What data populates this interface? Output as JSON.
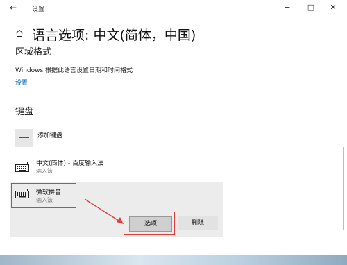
{
  "window": {
    "title": "设置",
    "back_glyph": "←",
    "minimize_glyph": "−",
    "maximize_glyph": "□",
    "close_glyph": "✕"
  },
  "header": {
    "icon": "home-icon",
    "title": "语言选项: 中文(简体，中国)"
  },
  "region": {
    "heading": "区域格式",
    "description": "Windows 根据此语言设置日期和时间格式",
    "link": "设置"
  },
  "keyboard": {
    "heading": "键盘",
    "add_label": "添加键盘",
    "items": [
      {
        "name": "中文(简体) - 百度输入法",
        "sub": "输入法",
        "icon": "keyboard-icon"
      },
      {
        "name": "微软拼音",
        "sub": "输入法",
        "icon": "keyboard-icon"
      }
    ],
    "options_button": "选项",
    "remove_button": "删除"
  },
  "colors": {
    "accent_link": "#0063b1",
    "highlight": "#e23b3b",
    "selected_bg": "#ececec"
  }
}
